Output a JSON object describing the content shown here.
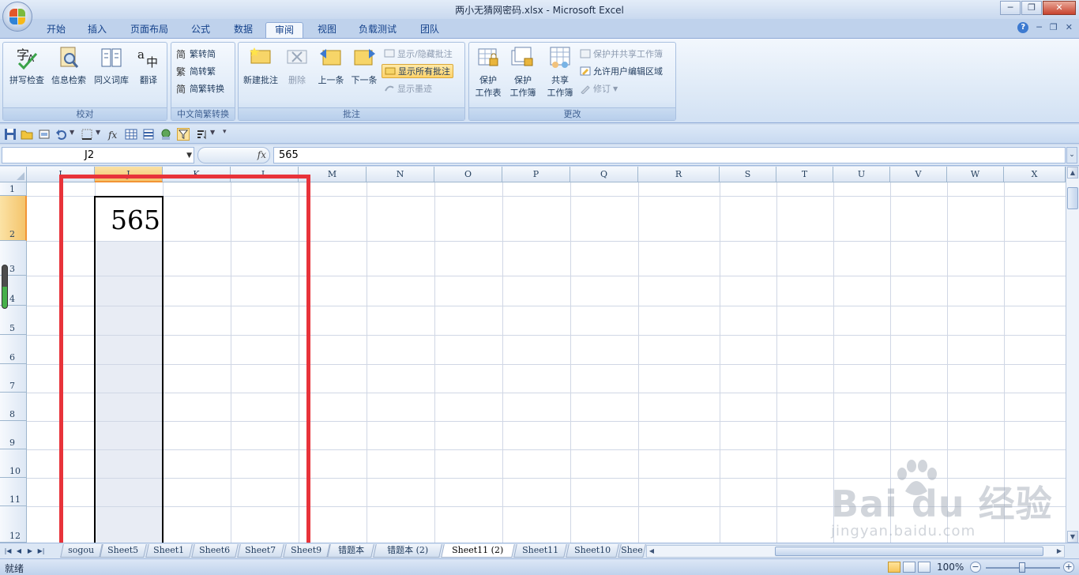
{
  "window": {
    "title": "两小无猜网密码.xlsx - Microsoft Excel",
    "minimize": "─",
    "restore": "❐",
    "close": "✕"
  },
  "ribbon_tabs": [
    "开始",
    "插入",
    "页面布局",
    "公式",
    "数据",
    "审阅",
    "视图",
    "负载测试",
    "团队"
  ],
  "active_tab": "审阅",
  "ribbon": {
    "proofing": {
      "label": "校对",
      "spell": "拼写检查",
      "research": "信息检索",
      "thesaurus": "同义词库",
      "translate": "翻译"
    },
    "chinese": {
      "label": "中文简繁转换",
      "to_simplified": "繁转简",
      "to_traditional": "简转繁",
      "convert": "简繁转换"
    },
    "comments": {
      "label": "批注",
      "new": "新建批注",
      "delete": "删除",
      "previous": "上一条",
      "next": "下一条",
      "show_hide": "显示/隐藏批注",
      "show_all": "显示所有批注",
      "show_ink": "显示墨迹"
    },
    "changes": {
      "label": "更改",
      "protect_sheet": [
        "保护",
        "工作表"
      ],
      "protect_workbook": [
        "保护",
        "工作簿"
      ],
      "share_workbook": [
        "共享",
        "工作簿"
      ],
      "protect_share": "保护并共享工作簿",
      "allow_edit": "允许用户编辑区域",
      "track": "修订"
    }
  },
  "formula_bar": {
    "name_box": "J2",
    "fx": "fx",
    "value": "565"
  },
  "columns": [
    "I",
    "J",
    "K",
    "L",
    "M",
    "N",
    "O",
    "P",
    "Q",
    "R",
    "S",
    "T",
    "U",
    "V",
    "W",
    "X"
  ],
  "rows": [
    "1",
    "2",
    "3",
    "4",
    "5",
    "6",
    "7",
    "8",
    "9",
    "10",
    "11",
    "12"
  ],
  "selected_column": "J",
  "selected_row": "2",
  "cells": {
    "J2": "565"
  },
  "sheet_tabs": [
    "sogou",
    "Sheet5",
    "Sheet1",
    "Sheet6",
    "Sheet7",
    "Sheet9",
    "错题本",
    "错题本 (2)",
    "Sheet11 (2)",
    "Sheet11",
    "Sheet10",
    "Shee"
  ],
  "active_sheet": "Sheet11 (2)",
  "status": {
    "ready": "就绪",
    "zoom": "100%",
    "zoom_level_percent": 100
  },
  "watermark": {
    "brand": "Bai du 经验",
    "url": "jingyan.baidu.com"
  },
  "colors": {
    "highlight_box": "#e8333a",
    "ribbon_blue": "#15428b",
    "selection_orange": "#f4c46b"
  }
}
